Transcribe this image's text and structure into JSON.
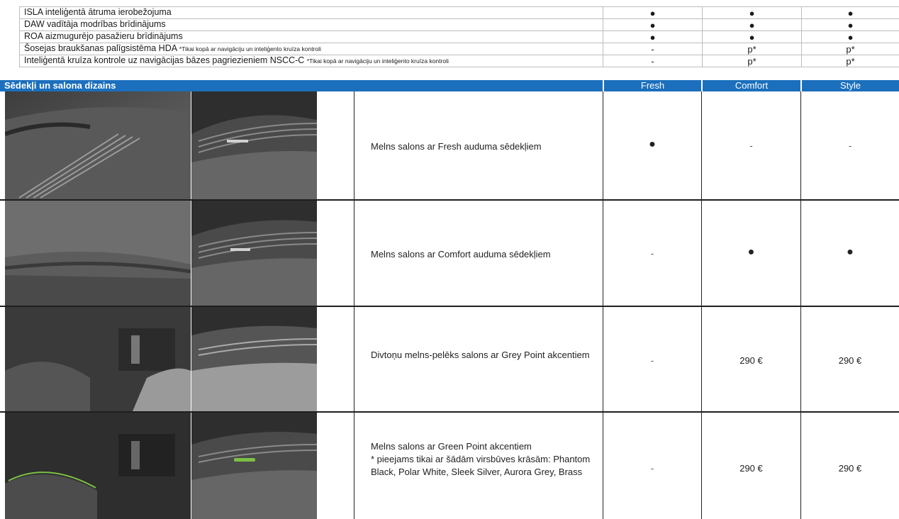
{
  "features": [
    {
      "label": "ISLA inteliģentā ātruma ierobežojuma",
      "note": "",
      "fresh": "●",
      "comfort": "●",
      "style": "●"
    },
    {
      "label": "DAW vadītāja modrības brīdinājums",
      "note": "",
      "fresh": "●",
      "comfort": "●",
      "style": "●"
    },
    {
      "label": "ROA aizmugurējo pasažieru brīdinājums",
      "note": "",
      "fresh": "●",
      "comfort": "●",
      "style": "●"
    },
    {
      "label": "Šosejas braukšanas palīgsistēma HDA",
      "note": "*Tikai kopā ar navigāciju un inteliģento kruīza kontroli",
      "fresh": "-",
      "comfort": "p*",
      "style": "p*"
    },
    {
      "label": "Inteliģentā kruīza kontrole uz navigācijas bāzes pagriezieniem NSCC-C",
      "note": "*Tikai kopā ar navigāciju un inteliģento kruīza kontroli",
      "fresh": "-",
      "comfort": "p*",
      "style": "p*"
    }
  ],
  "section": {
    "title": "Sēdekļi un salona dizains",
    "col_fresh": "Fresh",
    "col_comfort": "Comfort",
    "col_style": "Style"
  },
  "interiors": [
    {
      "desc": "Melns salons ar Fresh auduma sēdekļiem",
      "note": "",
      "fresh": "●",
      "comfort": "-",
      "style": "-"
    },
    {
      "desc": "Melns salons ar Comfort auduma sēdekļiem",
      "note": "",
      "fresh": "-",
      "comfort": "●",
      "style": "●"
    },
    {
      "desc": "Divtoņu melns-pelēks salons ar Grey Point akcentiem",
      "note": "",
      "fresh": "-",
      "comfort": "290 €",
      "style": "290 €"
    },
    {
      "desc": "Melns salons ar Green Point akcentiem",
      "note": "*   pieejams tikai ar šādām virsbūves krāsām: Phantom Black, Polar White, Sleek Silver, Aurora Grey, Brass",
      "fresh": "-",
      "comfort": "290 €",
      "style": "290 €"
    }
  ],
  "colors": {
    "header_bg": "#1b6fbd",
    "accent_green": "#7bc043"
  }
}
